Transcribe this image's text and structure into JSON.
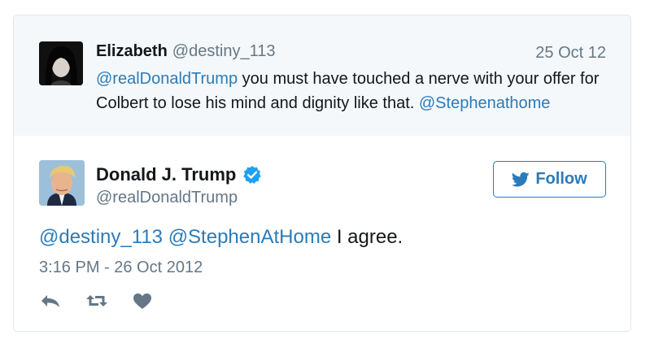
{
  "reply_context": {
    "name": "Elizabeth",
    "handle": "@destiny_113",
    "date": "25 Oct 12",
    "text_mention_1": "@realDonaldTrump",
    "text_body": " you must have touched a nerve with your offer for Colbert to lose his mind and dignity like that. ",
    "text_mention_2": "@Stephenathome",
    "avatar_icon": "profile-photo-icon"
  },
  "tweet": {
    "name": "Donald J. Trump",
    "handle": "@realDonaldTrump",
    "verified_icon": "verified-badge-icon",
    "follow_label": "Follow",
    "follow_icon": "twitter-bird-icon",
    "mention_1": "@destiny_113",
    "mention_2": "@StephenAtHome",
    "text_body": " I agree.",
    "timestamp": "3:16 PM - 26 Oct 2012",
    "actions": [
      "reply-icon",
      "retweet-icon",
      "like-icon"
    ]
  },
  "colors": {
    "link": "#2b7bb9",
    "secondary_text": "#657786",
    "context_background": "#f5f8fa",
    "verified": "#1da1f2",
    "action_icons": "#657786"
  }
}
